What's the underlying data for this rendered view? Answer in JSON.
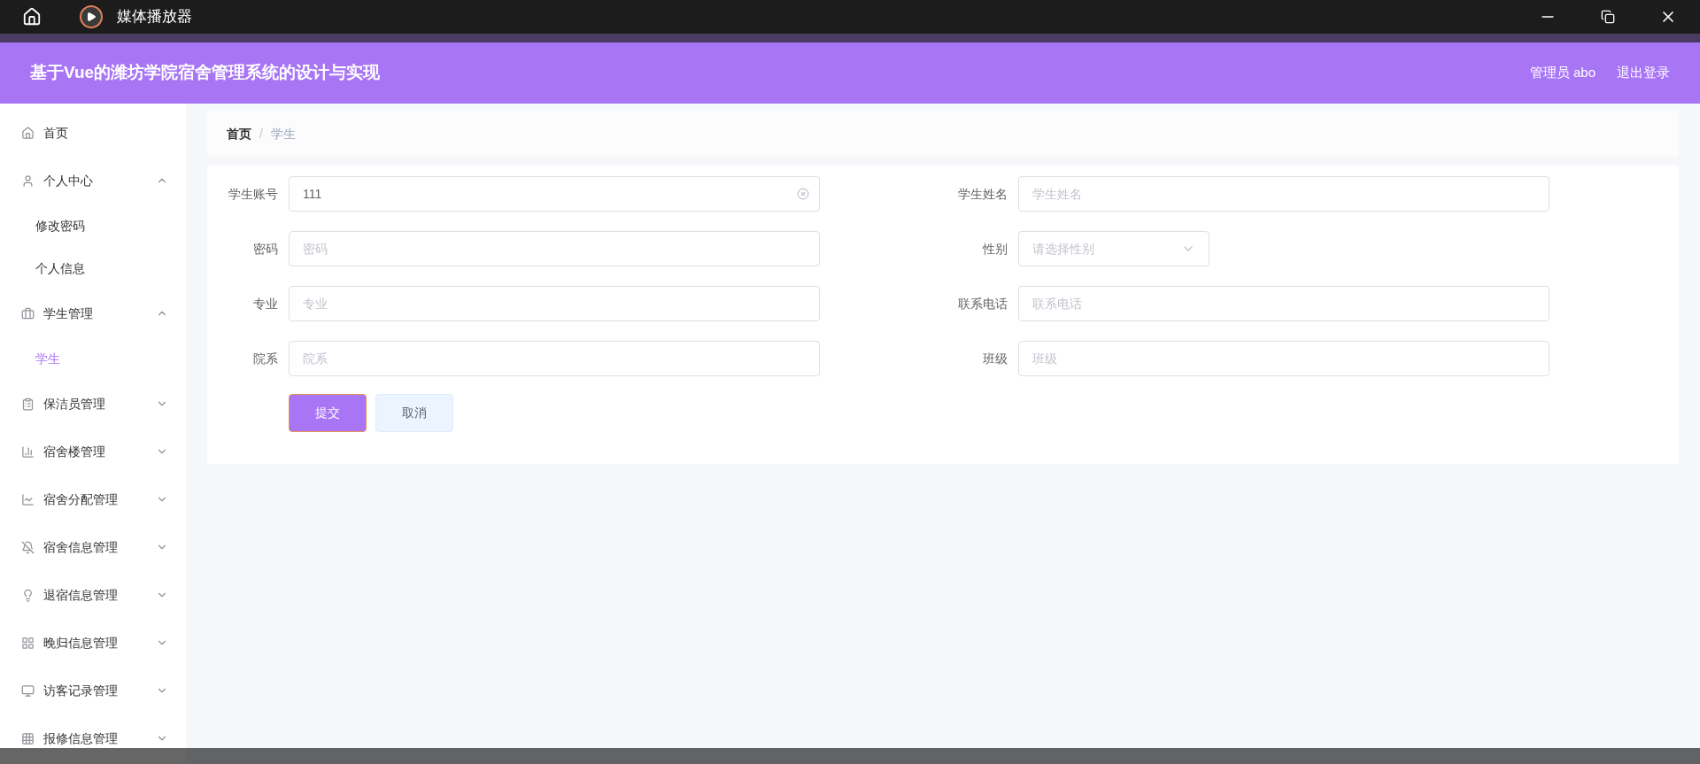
{
  "window": {
    "title": "媒体播放器"
  },
  "header": {
    "title": "基于Vue的潍坊学院宿舍管理系统的设计与实现",
    "user": "管理员 abo",
    "logout": "退出登录"
  },
  "sidebar": {
    "items": [
      {
        "label": "首页",
        "kind": "link",
        "selected": false
      },
      {
        "label": "个人中心",
        "kind": "group",
        "expanded": true,
        "selected": false,
        "children": [
          {
            "label": "修改密码",
            "selected": false
          },
          {
            "label": "个人信息",
            "selected": false
          }
        ]
      },
      {
        "label": "学生管理",
        "kind": "group",
        "expanded": true,
        "selected": false,
        "children": [
          {
            "label": "学生",
            "selected": true
          }
        ]
      },
      {
        "label": "保洁员管理",
        "kind": "group",
        "expanded": false,
        "selected": false
      },
      {
        "label": "宿舍楼管理",
        "kind": "group",
        "expanded": false,
        "selected": false
      },
      {
        "label": "宿舍分配管理",
        "kind": "group",
        "expanded": false,
        "selected": false
      },
      {
        "label": "宿舍信息管理",
        "kind": "group",
        "expanded": false,
        "selected": false
      },
      {
        "label": "退宿信息管理",
        "kind": "group",
        "expanded": false,
        "selected": false
      },
      {
        "label": "晚归信息管理",
        "kind": "group",
        "expanded": false,
        "selected": false
      },
      {
        "label": "访客记录管理",
        "kind": "group",
        "expanded": false,
        "selected": false
      },
      {
        "label": "报修信息管理",
        "kind": "group",
        "expanded": false,
        "selected": false
      }
    ]
  },
  "breadcrumb": {
    "separator": "/",
    "items": [
      "首页",
      "学生"
    ]
  },
  "form": {
    "fields": [
      {
        "label": "学生账号",
        "kind": "input",
        "value": "111",
        "clearable": true
      },
      {
        "label": "学生姓名",
        "kind": "input",
        "placeholder": "学生姓名"
      },
      {
        "label": "密码",
        "kind": "input",
        "placeholder": "密码"
      },
      {
        "label": "性别",
        "kind": "select",
        "placeholder": "请选择性别"
      },
      {
        "label": "专业",
        "kind": "input",
        "placeholder": "专业"
      },
      {
        "label": "联系电话",
        "kind": "input",
        "placeholder": "联系电话"
      },
      {
        "label": "院系",
        "kind": "input",
        "placeholder": "院系"
      },
      {
        "label": "班级",
        "kind": "input",
        "placeholder": "班级"
      }
    ],
    "buttons": [
      {
        "label": "提交",
        "kind": "primary"
      },
      {
        "label": "取消",
        "kind": "secondary"
      }
    ]
  }
}
